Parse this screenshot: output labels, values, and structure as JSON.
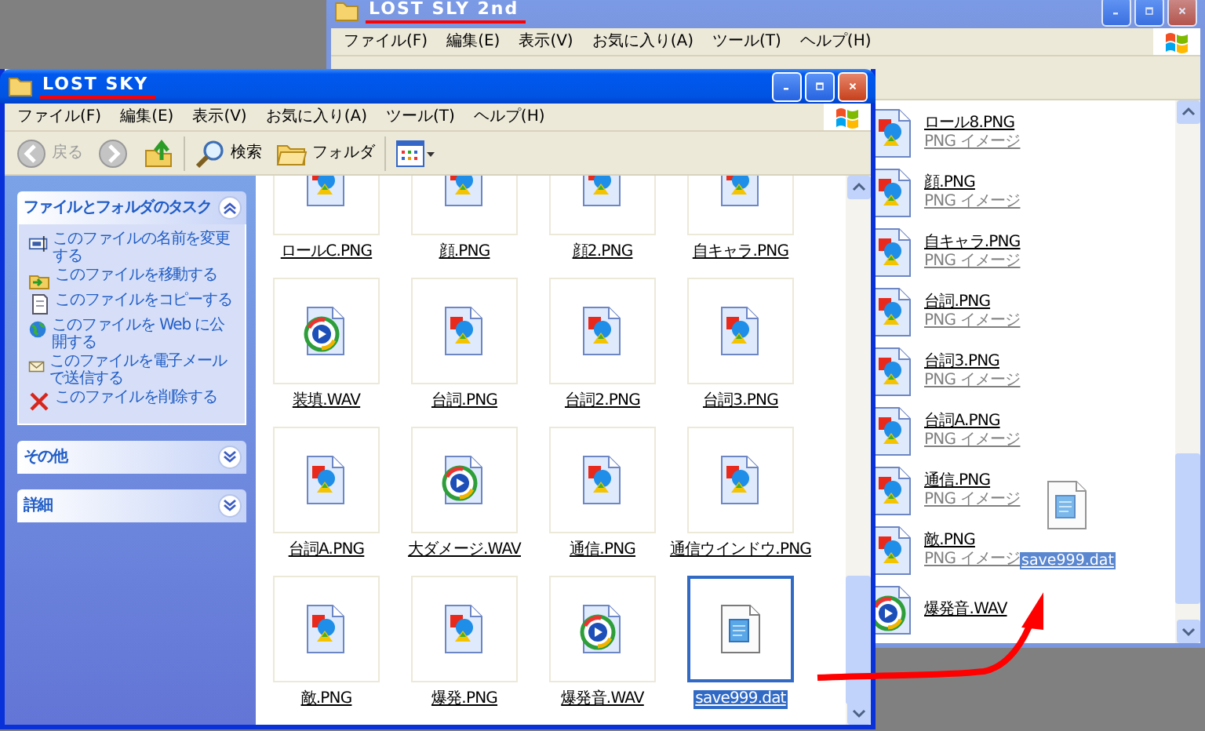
{
  "windows": [
    {
      "title": "LOST SLY 2nd",
      "active": false,
      "menu": [
        "ファイル(F)",
        "編集(E)",
        "表示(V)",
        "お気に入り(A)",
        "ツール(T)",
        "ヘルプ(H)"
      ],
      "files": [
        {
          "name": "ロール8.PNG",
          "kind": "image",
          "type": "PNG イメージ"
        },
        {
          "name": "顔.PNG",
          "kind": "image",
          "type": "PNG イメージ"
        },
        {
          "name": "自キャラ.PNG",
          "kind": "image",
          "type": "PNG イメージ"
        },
        {
          "name": "台詞.PNG",
          "kind": "image",
          "type": "PNG イメージ"
        },
        {
          "name": "台詞3.PNG",
          "kind": "image",
          "type": "PNG イメージ"
        },
        {
          "name": "台詞A.PNG",
          "kind": "image",
          "type": "PNG イメージ"
        },
        {
          "name": "通信.PNG",
          "kind": "image",
          "type": "PNG イメージ"
        },
        {
          "name": "敵.PNG",
          "kind": "image",
          "type": "PNG イメージ"
        },
        {
          "name": "爆発音.WAV",
          "kind": "audio"
        }
      ],
      "drag_ghost": {
        "name": "save999.dat",
        "kind": "data"
      }
    },
    {
      "title": "LOST SKY",
      "active": true,
      "menu": [
        "ファイル(F)",
        "編集(E)",
        "表示(V)",
        "お気に入り(A)",
        "ツール(T)",
        "ヘルプ(H)"
      ],
      "toolbar": [
        {
          "kind": "back",
          "label": "戻る"
        },
        {
          "kind": "forward"
        },
        {
          "kind": "up"
        },
        {
          "kind": "search",
          "label": "検索"
        },
        {
          "kind": "folders",
          "label": "フォルダ"
        },
        {
          "kind": "views"
        }
      ],
      "task_panels": [
        {
          "title": "ファイルとフォルダのタスク",
          "expanded": true,
          "tasks": [
            {
              "kind": "rename",
              "label": "このファイルの名前を変更する"
            },
            {
              "kind": "move",
              "label": "このファイルを移動する"
            },
            {
              "kind": "copy",
              "label": "このファイルをコピーする"
            },
            {
              "kind": "publish",
              "label": "このファイルを Web に公開する"
            },
            {
              "kind": "mail",
              "label": "このファイルを電子メールで送信する"
            },
            {
              "kind": "delete",
              "label": "このファイルを削除する"
            }
          ]
        },
        {
          "title": "その他",
          "expanded": false
        },
        {
          "title": "詳細",
          "expanded": false
        }
      ],
      "files": [
        {
          "name": "ロールC.PNG",
          "kind": "image",
          "selected": false
        },
        {
          "name": "顔.PNG",
          "kind": "image",
          "selected": false
        },
        {
          "name": "顔2.PNG",
          "kind": "image",
          "selected": false
        },
        {
          "name": "自キャラ.PNG",
          "kind": "image",
          "selected": false
        },
        {
          "name": "装填.WAV",
          "kind": "audio",
          "selected": false
        },
        {
          "name": "台詞.PNG",
          "kind": "image",
          "selected": false
        },
        {
          "name": "台詞2.PNG",
          "kind": "image",
          "selected": false
        },
        {
          "name": "台詞3.PNG",
          "kind": "image",
          "selected": false
        },
        {
          "name": "台詞A.PNG",
          "kind": "image",
          "selected": false
        },
        {
          "name": "大ダメージ.WAV",
          "kind": "audio",
          "selected": false
        },
        {
          "name": "通信.PNG",
          "kind": "image",
          "selected": false
        },
        {
          "name": "通信ウインドウ.PNG",
          "kind": "image",
          "selected": false
        },
        {
          "name": "敵.PNG",
          "kind": "image",
          "selected": false
        },
        {
          "name": "爆発.PNG",
          "kind": "image",
          "selected": false
        },
        {
          "name": "爆発音.WAV",
          "kind": "audio",
          "selected": false
        },
        {
          "name": "save999.dat",
          "kind": "data",
          "selected": true
        }
      ]
    }
  ]
}
